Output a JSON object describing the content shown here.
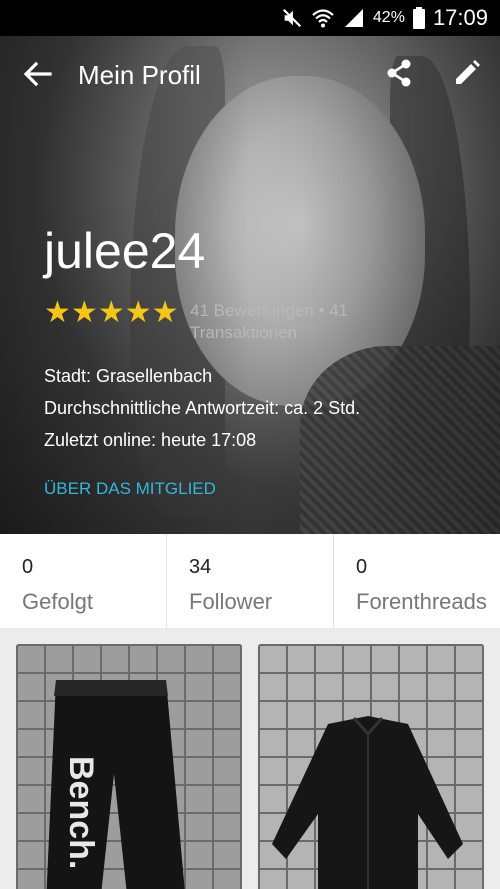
{
  "status_bar": {
    "battery": "42%",
    "time": "17:09"
  },
  "header": {
    "title": "Mein Profil"
  },
  "profile": {
    "username": "julee24",
    "stars": 5,
    "ratings_text": "41 Bewertungen • 41 Transaktionen",
    "city_label": "Stadt:",
    "city": "Grasellenbach",
    "response_label": "Durchschnittliche Antwortzeit:",
    "response_value": "ca. 2 Std.",
    "last_online": "Zuletzt online: heute 17:08",
    "about_link": "ÜBER DAS MITGLIED"
  },
  "stats": [
    {
      "value": "0",
      "label": "Gefolgt"
    },
    {
      "value": "34",
      "label": "Follower"
    },
    {
      "value": "0",
      "label": "Forenthreads"
    }
  ],
  "listings": [
    {
      "brand_text": "Bench."
    },
    {
      "brand_text": ""
    }
  ],
  "colors": {
    "accent_link": "#33b8d8",
    "star": "#f5c518",
    "status_bar": "#000000"
  }
}
